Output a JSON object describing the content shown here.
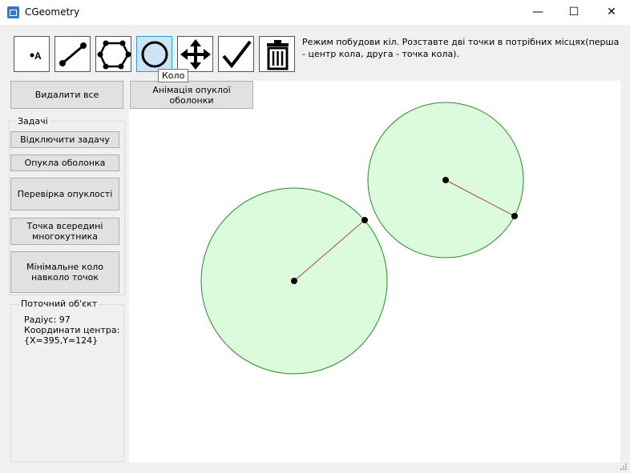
{
  "window": {
    "title": "CGeometry",
    "minimize": "—",
    "maximize": "☐",
    "close": "✕"
  },
  "toolbar": {
    "tools": [
      {
        "name": "point-tool",
        "icon": "point-icon",
        "label": "A"
      },
      {
        "name": "segment-tool",
        "icon": "segment-icon"
      },
      {
        "name": "polygon-tool",
        "icon": "polygon-icon"
      },
      {
        "name": "circle-tool",
        "icon": "circle-icon",
        "active": true
      },
      {
        "name": "move-tool",
        "icon": "move-icon"
      },
      {
        "name": "check-tool",
        "icon": "check-icon"
      },
      {
        "name": "delete-tool",
        "icon": "trash-icon"
      }
    ],
    "hint": "Режим побудови кіл. Розставте дві точки в потрібних місцях(перша - центр кола, друга - точка кола).",
    "tooltip": "Коло"
  },
  "buttons": {
    "delete_all": "Видалити все",
    "hull_animation": "Анімація опуклої оболонки"
  },
  "tasks": {
    "label": "Задачі",
    "items": [
      "Відключити задачу",
      "Опукла оболонка",
      "Перевірка опуклості",
      "Точка всередині многокутника",
      "Мінімальне коло навколо точок"
    ]
  },
  "current_object": {
    "label": "Поточний об'єкт",
    "radius": "Радіус: 97",
    "center_label": "Координати центра:",
    "center_value": "{X=395,Y=124}"
  },
  "colors": {
    "circle_fill": "#dcfadc",
    "circle_stroke": "#2a8a2a",
    "radius_line": "#a05040",
    "accent": "#26a0da"
  }
}
